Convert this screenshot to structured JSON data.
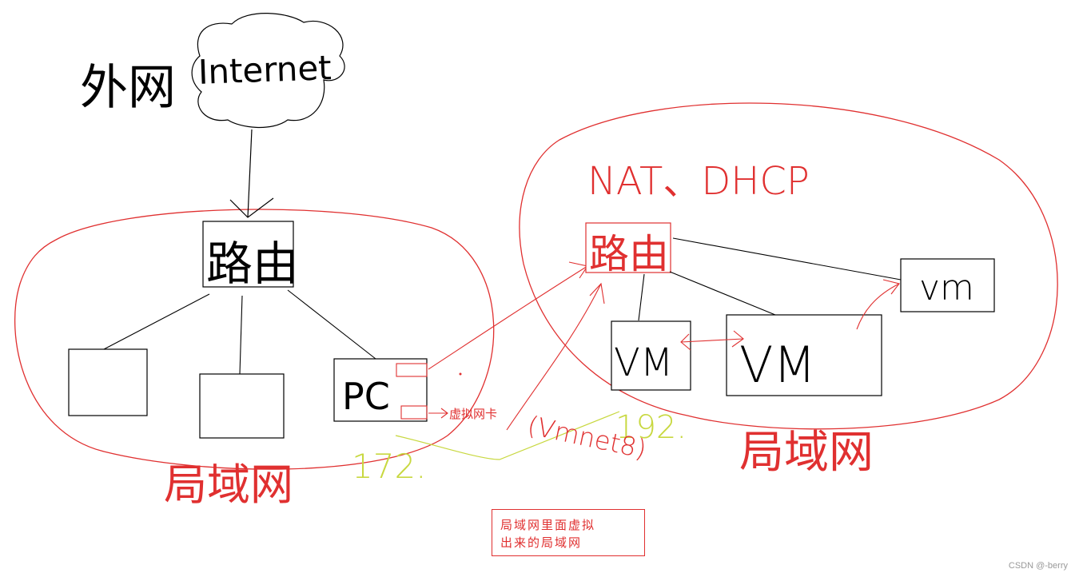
{
  "colors": {
    "ink": "#000000",
    "red": "#e03030",
    "yellow_green": "#c8d840",
    "watermark": "#999999"
  },
  "internet": {
    "label": "Internet",
    "prefix_label": "外网"
  },
  "left_lan": {
    "router_label": "路由",
    "pc_label": "PC",
    "nic_label": "虚拟网卡",
    "lan_label": "局域网"
  },
  "right_lan": {
    "top_label": "NAT、DHCP",
    "router_label": "路由",
    "vm_labels": [
      "vm",
      "VM",
      "VM"
    ],
    "lan_label": "局域网"
  },
  "link_labels": {
    "vmnet": "(Vmnet8)",
    "ip_left": "172.",
    "ip_right": "192."
  },
  "note": {
    "line1": "局域网里面虚拟",
    "line2": "出来的局域网"
  },
  "watermark": "CSDN @-berry"
}
